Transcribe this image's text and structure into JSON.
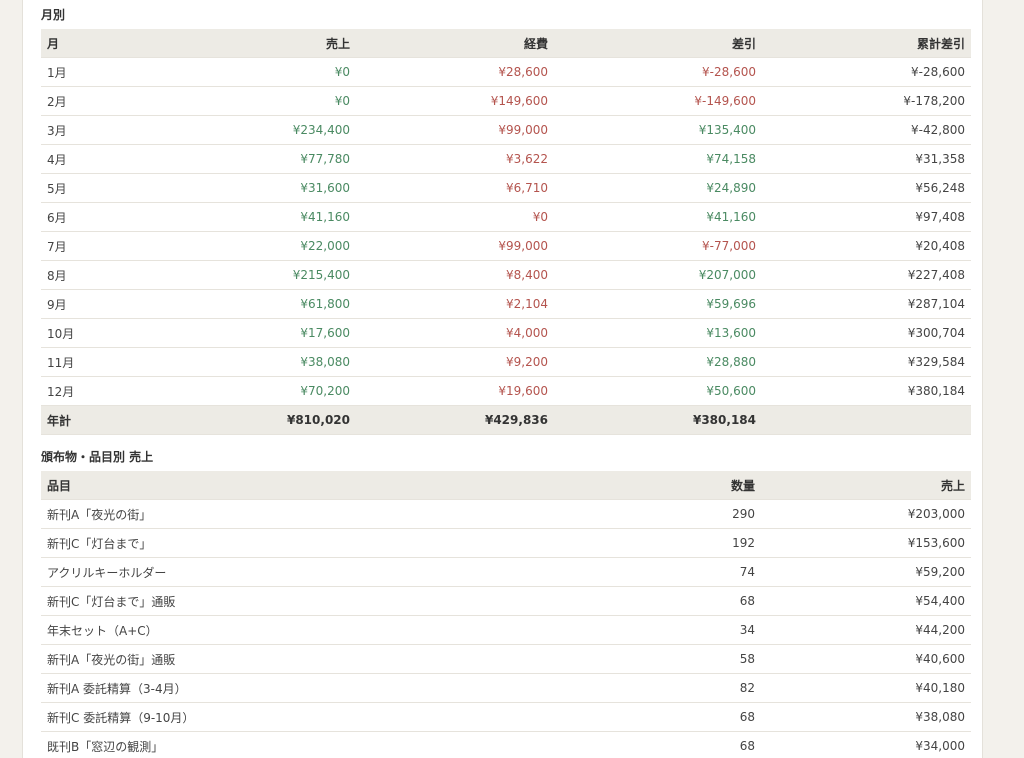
{
  "monthly": {
    "title": "月別",
    "headers": [
      "月",
      "売上",
      "経費",
      "差引",
      "累計差引"
    ],
    "rows": [
      {
        "month": "1月",
        "sales": "¥0",
        "sales_c": "pos",
        "exp": "¥28,600",
        "diff": "¥-28,600",
        "diff_c": "neg",
        "cum": "¥-28,600"
      },
      {
        "month": "2月",
        "sales": "¥0",
        "sales_c": "pos",
        "exp": "¥149,600",
        "diff": "¥-149,600",
        "diff_c": "neg",
        "cum": "¥-178,200"
      },
      {
        "month": "3月",
        "sales": "¥234,400",
        "sales_c": "pos",
        "exp": "¥99,000",
        "diff": "¥135,400",
        "diff_c": "pos",
        "cum": "¥-42,800"
      },
      {
        "month": "4月",
        "sales": "¥77,780",
        "sales_c": "pos",
        "exp": "¥3,622",
        "diff": "¥74,158",
        "diff_c": "pos",
        "cum": "¥31,358"
      },
      {
        "month": "5月",
        "sales": "¥31,600",
        "sales_c": "pos",
        "exp": "¥6,710",
        "diff": "¥24,890",
        "diff_c": "pos",
        "cum": "¥56,248"
      },
      {
        "month": "6月",
        "sales": "¥41,160",
        "sales_c": "pos",
        "exp": "¥0",
        "diff": "¥41,160",
        "diff_c": "pos",
        "cum": "¥97,408"
      },
      {
        "month": "7月",
        "sales": "¥22,000",
        "sales_c": "pos",
        "exp": "¥99,000",
        "diff": "¥-77,000",
        "diff_c": "neg",
        "cum": "¥20,408"
      },
      {
        "month": "8月",
        "sales": "¥215,400",
        "sales_c": "pos",
        "exp": "¥8,400",
        "diff": "¥207,000",
        "diff_c": "pos",
        "cum": "¥227,408"
      },
      {
        "month": "9月",
        "sales": "¥61,800",
        "sales_c": "pos",
        "exp": "¥2,104",
        "diff": "¥59,696",
        "diff_c": "pos",
        "cum": "¥287,104"
      },
      {
        "month": "10月",
        "sales": "¥17,600",
        "sales_c": "pos",
        "exp": "¥4,000",
        "diff": "¥13,600",
        "diff_c": "pos",
        "cum": "¥300,704"
      },
      {
        "month": "11月",
        "sales": "¥38,080",
        "sales_c": "pos",
        "exp": "¥9,200",
        "diff": "¥28,880",
        "diff_c": "pos",
        "cum": "¥329,584"
      },
      {
        "month": "12月",
        "sales": "¥70,200",
        "sales_c": "pos",
        "exp": "¥19,600",
        "diff": "¥50,600",
        "diff_c": "pos",
        "cum": "¥380,184"
      }
    ],
    "total": {
      "label": "年計",
      "sales": "¥810,020",
      "exp": "¥429,836",
      "diff": "¥380,184",
      "cum": ""
    }
  },
  "items": {
    "title": "頒布物・品目別 売上",
    "headers": [
      "品目",
      "数量",
      "売上"
    ],
    "rows": [
      {
        "name": "新刊A「夜光の街」",
        "qty": "290",
        "sales": "¥203,000"
      },
      {
        "name": "新刊C「灯台まで」",
        "qty": "192",
        "sales": "¥153,600"
      },
      {
        "name": "アクリルキーホルダー",
        "qty": "74",
        "sales": "¥59,200"
      },
      {
        "name": "新刊C「灯台まで」通販",
        "qty": "68",
        "sales": "¥54,400"
      },
      {
        "name": "年末セット（A+C）",
        "qty": "34",
        "sales": "¥44,200"
      },
      {
        "name": "新刊A「夜光の街」通販",
        "qty": "58",
        "sales": "¥40,600"
      },
      {
        "name": "新刊A 委託精算（3-4月）",
        "qty": "82",
        "sales": "¥40,180"
      },
      {
        "name": "新刊C 委託精算（9-10月）",
        "qty": "68",
        "sales": "¥38,080"
      },
      {
        "name": "既刊B「窓辺の観測」",
        "qty": "68",
        "sales": "¥34,000"
      }
    ]
  },
  "colors": {
    "positive": "#4a8a62",
    "negative": "#b4544e",
    "header_bg": "#edebe5"
  }
}
